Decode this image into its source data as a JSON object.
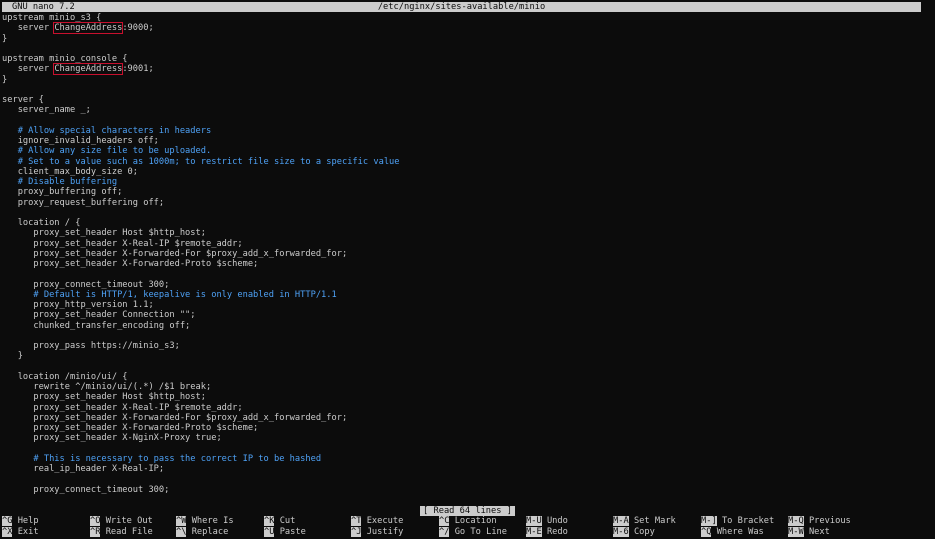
{
  "titlebar": {
    "app": "GNU nano 7.2",
    "file": "/etc/nginx/sites-available/minio"
  },
  "lines": [
    {
      "type": "code",
      "pre": "upstream minio_s3 {"
    },
    {
      "type": "code",
      "pre": "   server ",
      "hl": "ChangeAddress",
      "post": ":9000;"
    },
    {
      "type": "code",
      "pre": "}"
    },
    {
      "type": "code",
      "pre": ""
    },
    {
      "type": "code",
      "pre": "upstream minio_console {"
    },
    {
      "type": "code",
      "pre": "   server ",
      "hl": "ChangeAddress",
      "post": ":9001;"
    },
    {
      "type": "code",
      "pre": "}"
    },
    {
      "type": "code",
      "pre": ""
    },
    {
      "type": "code",
      "pre": "server {"
    },
    {
      "type": "code",
      "pre": "   server_name _;"
    },
    {
      "type": "code",
      "pre": ""
    },
    {
      "type": "comment",
      "pre": "   # Allow special characters in headers"
    },
    {
      "type": "code",
      "pre": "   ignore_invalid_headers off;"
    },
    {
      "type": "comment",
      "pre": "   # Allow any size file to be uploaded."
    },
    {
      "type": "comment",
      "pre": "   # Set to a value such as 1000m; to restrict file size to a specific value"
    },
    {
      "type": "code",
      "pre": "   client_max_body_size 0;"
    },
    {
      "type": "comment",
      "pre": "   # Disable buffering"
    },
    {
      "type": "code",
      "pre": "   proxy_buffering off;"
    },
    {
      "type": "code",
      "pre": "   proxy_request_buffering off;"
    },
    {
      "type": "code",
      "pre": ""
    },
    {
      "type": "code",
      "pre": "   location / {"
    },
    {
      "type": "code",
      "pre": "      proxy_set_header Host $http_host;"
    },
    {
      "type": "code",
      "pre": "      proxy_set_header X-Real-IP $remote_addr;"
    },
    {
      "type": "code",
      "pre": "      proxy_set_header X-Forwarded-For $proxy_add_x_forwarded_for;"
    },
    {
      "type": "code",
      "pre": "      proxy_set_header X-Forwarded-Proto $scheme;"
    },
    {
      "type": "code",
      "pre": ""
    },
    {
      "type": "code",
      "pre": "      proxy_connect_timeout 300;"
    },
    {
      "type": "comment",
      "pre": "      # Default is HTTP/1, keepalive is only enabled in HTTP/1.1"
    },
    {
      "type": "code",
      "pre": "      proxy_http_version 1.1;"
    },
    {
      "type": "code",
      "pre": "      proxy_set_header Connection \"\";"
    },
    {
      "type": "code",
      "pre": "      chunked_transfer_encoding off;"
    },
    {
      "type": "code",
      "pre": ""
    },
    {
      "type": "code",
      "pre": "      proxy_pass https://minio_s3;"
    },
    {
      "type": "code",
      "pre": "   }"
    },
    {
      "type": "code",
      "pre": ""
    },
    {
      "type": "code",
      "pre": "   location /minio/ui/ {"
    },
    {
      "type": "code",
      "pre": "      rewrite ^/minio/ui/(.*) /$1 break;"
    },
    {
      "type": "code",
      "pre": "      proxy_set_header Host $http_host;"
    },
    {
      "type": "code",
      "pre": "      proxy_set_header X-Real-IP $remote_addr;"
    },
    {
      "type": "code",
      "pre": "      proxy_set_header X-Forwarded-For $proxy_add_x_forwarded_for;"
    },
    {
      "type": "code",
      "pre": "      proxy_set_header X-Forwarded-Proto $scheme;"
    },
    {
      "type": "code",
      "pre": "      proxy_set_header X-NginX-Proxy true;"
    },
    {
      "type": "code",
      "pre": ""
    },
    {
      "type": "comment",
      "pre": "      # This is necessary to pass the correct IP to be hashed"
    },
    {
      "type": "code",
      "pre": "      real_ip_header X-Real-IP;"
    },
    {
      "type": "code",
      "pre": ""
    },
    {
      "type": "code",
      "pre": "      proxy_connect_timeout 300;"
    }
  ],
  "status": "[ Read 64 lines ]",
  "shortcuts": {
    "row1": [
      {
        "key": "^G",
        "label": "Help"
      },
      {
        "key": "^O",
        "label": "Write Out"
      },
      {
        "key": "^W",
        "label": "Where Is"
      },
      {
        "key": "^K",
        "label": "Cut"
      },
      {
        "key": "^T",
        "label": "Execute"
      },
      {
        "key": "^C",
        "label": "Location"
      },
      {
        "key": "M-U",
        "label": "Undo"
      },
      {
        "key": "M-A",
        "label": "Set Mark"
      },
      {
        "key": "M-]",
        "label": "To Bracket"
      },
      {
        "key": "M-Q",
        "label": "Previous"
      }
    ],
    "row2": [
      {
        "key": "^X",
        "label": "Exit"
      },
      {
        "key": "^R",
        "label": "Read File"
      },
      {
        "key": "^\\",
        "label": "Replace"
      },
      {
        "key": "^U",
        "label": "Paste"
      },
      {
        "key": "^J",
        "label": "Justify"
      },
      {
        "key": "^/",
        "label": "Go To Line"
      },
      {
        "key": "M-E",
        "label": "Redo"
      },
      {
        "key": "M-6",
        "label": "Copy"
      },
      {
        "key": "^Q",
        "label": "Where Was"
      },
      {
        "key": "M-W",
        "label": "Next"
      }
    ]
  }
}
